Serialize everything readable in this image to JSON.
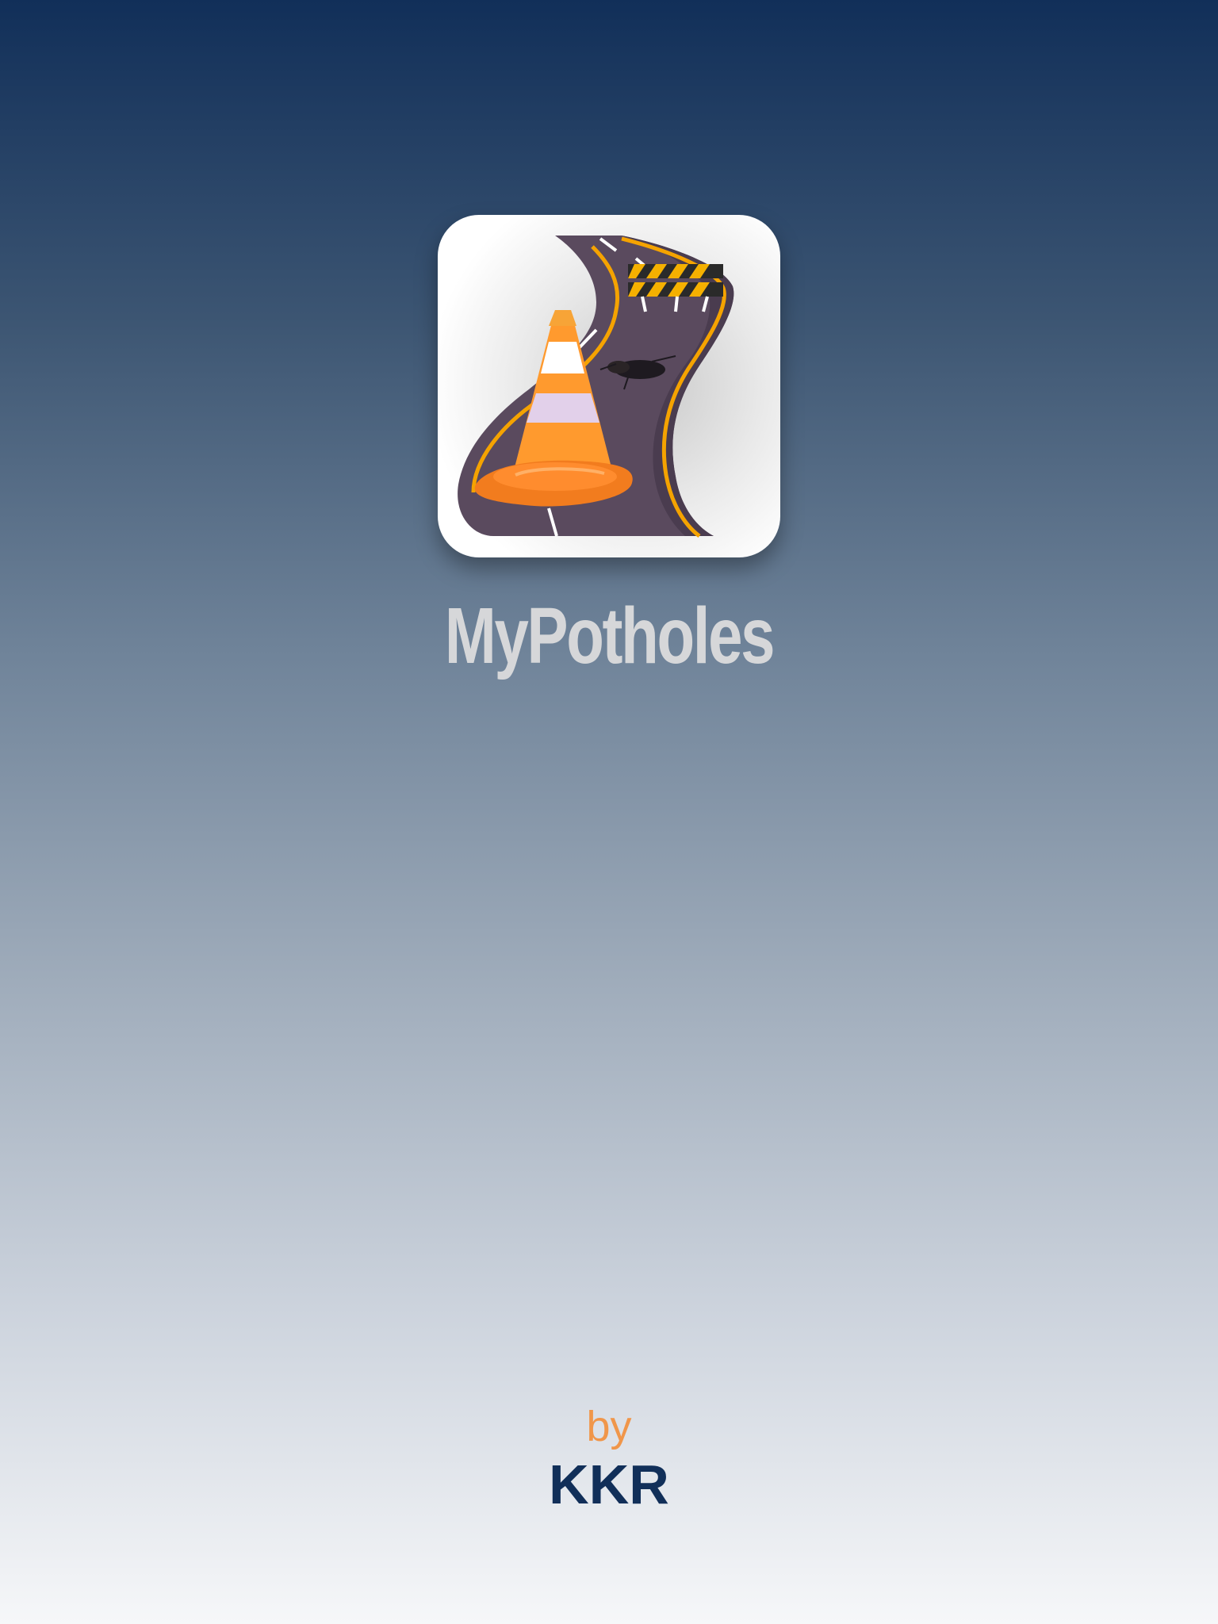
{
  "splash": {
    "app_name": "MyPotholes",
    "by_label": "by",
    "author": "KKR",
    "app_icon": "road-cone-pothole-icon"
  },
  "colors": {
    "background_top": "#112f59",
    "background_bottom": "#f6f7f9",
    "title": "#d6d7d9",
    "by_label": "#f0964a",
    "author": "#112f59",
    "cone_orange": "#ff8c2e",
    "road": "#5a4a5e",
    "road_line": "#f5a300"
  }
}
